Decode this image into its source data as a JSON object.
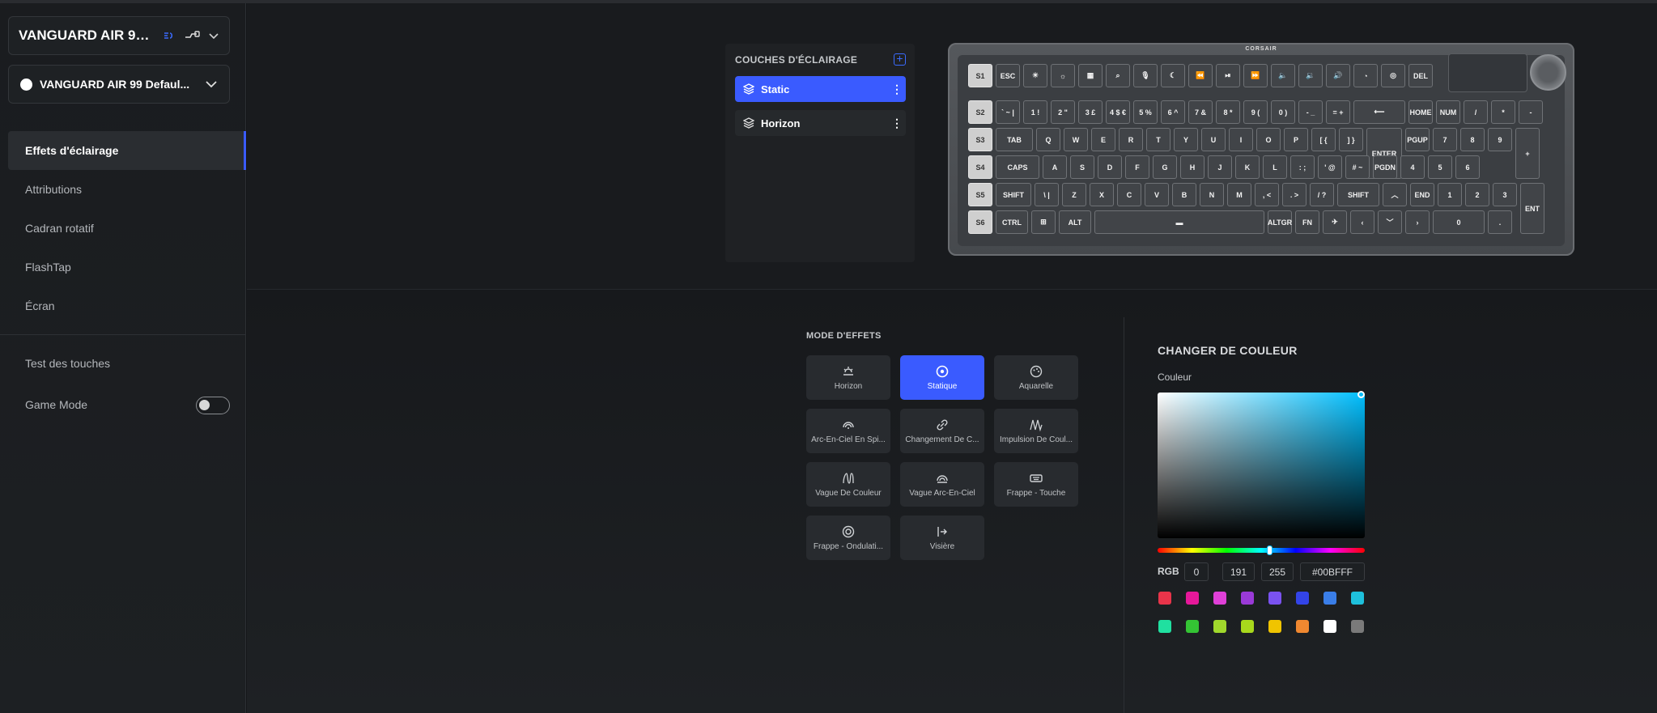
{
  "device": {
    "name": "VANGUARD AIR 99 ..."
  },
  "profile": {
    "name": "VANGUARD AIR 99 Defaul..."
  },
  "nav": [
    {
      "label": "Effets d'éclairage",
      "active": true
    },
    {
      "label": "Attributions"
    },
    {
      "label": "Cadran rotatif"
    },
    {
      "label": "FlashTap"
    },
    {
      "label": "Écran"
    }
  ],
  "bottom_nav": {
    "test": "Test des touches",
    "game": "Game Mode",
    "game_mode_on": false
  },
  "layers": {
    "title": "COUCHES D'ÉCLAIRAGE",
    "items": [
      {
        "label": "Static",
        "active": true
      },
      {
        "label": "Horizon",
        "active": false
      }
    ]
  },
  "keyboard": {
    "brand": "CORSAIR",
    "rows": [
      [
        "S1",
        "ESC",
        "☀",
        "☼",
        "▦",
        "⌕",
        "🎙",
        "☾",
        "⏪",
        "⏯",
        "⏩",
        "🔈",
        "🔉",
        "🔊",
        "◔",
        "◎",
        "DEL"
      ],
      [
        "S2",
        "` ~ |",
        "1 !",
        "2 \"",
        "3 £",
        "4 $ €",
        "5 %",
        "6 ^",
        "7 &",
        "8 *",
        "9 (",
        "0 )",
        "- _",
        "= +",
        "⟵",
        "HOME",
        "NUM",
        "/",
        "*",
        "-"
      ],
      [
        "S3",
        "TAB",
        "Q",
        "W",
        "E",
        "R",
        "T",
        "Y",
        "U",
        "I",
        "O",
        "P",
        "[ {",
        "] }",
        "ENTER",
        "PGUP",
        "7",
        "8",
        "9",
        "+"
      ],
      [
        "S4",
        "CAPS",
        "A",
        "S",
        "D",
        "F",
        "G",
        "H",
        "J",
        "K",
        "L",
        ": ;",
        "' @",
        "# ~",
        "PGDN",
        "4",
        "5",
        "6"
      ],
      [
        "S5",
        "SHIFT",
        "\\ |",
        "Z",
        "X",
        "C",
        "V",
        "B",
        "N",
        "M",
        ", <",
        ". >",
        "/ ?",
        "SHIFT",
        "︿",
        "END",
        "1",
        "2",
        "3",
        "ENT"
      ],
      [
        "S6",
        "CTRL",
        "⊞",
        "ALT",
        "▬",
        "ALTGR",
        "FN",
        "✈",
        "‹",
        "﹀",
        "›",
        "0",
        "."
      ]
    ]
  },
  "effects": {
    "title": "MODE D'EFFETS",
    "items": [
      {
        "label": "Horizon",
        "icon": "sunrise-icon"
      },
      {
        "label": "Statique",
        "icon": "target-icon",
        "active": true
      },
      {
        "label": "Aquarelle",
        "icon": "palette-icon"
      },
      {
        "label": "Arc-En-Ciel En Spi...",
        "icon": "rainbow-spiral-icon"
      },
      {
        "label": "Changement De C...",
        "icon": "link-icon"
      },
      {
        "label": "Impulsion De Coul...",
        "icon": "pulse-icon"
      },
      {
        "label": "Vague De Couleur",
        "icon": "wave-icon"
      },
      {
        "label": "Vague Arc-En-Ciel",
        "icon": "rainbow-wave-icon"
      },
      {
        "label": "Frappe - Touche",
        "icon": "keyboard-icon"
      },
      {
        "label": "Frappe - Ondulati...",
        "icon": "ripple-icon"
      },
      {
        "label": "Visière",
        "icon": "visor-icon"
      }
    ]
  },
  "color": {
    "title": "CHANGER DE COULEUR",
    "subtitle": "Couleur",
    "rgb_label": "RGB",
    "r": "0",
    "g": "191",
    "b": "255",
    "hex": "#00BFFF",
    "current": "#00bfff",
    "swatches_row1": [
      "#e8344a",
      "#e6189a",
      "#e040d8",
      "#9a3ad8",
      "#7a52f0",
      "#3344e8",
      "#3a7ee8",
      "#1ec0dc"
    ],
    "swatches_row2": [
      "#20e0a0",
      "#34c434",
      "#a0d82c",
      "#a8d81c",
      "#f0c400",
      "#f08830",
      "#ffffff",
      "#7a7a7a"
    ]
  }
}
